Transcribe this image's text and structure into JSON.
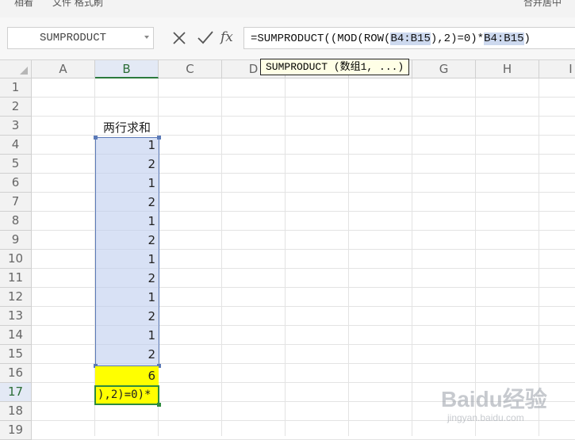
{
  "toolbar": {
    "left_fragment": "相看",
    "middle_fragment": "文件 格式刷",
    "right_fragment": "合并居中"
  },
  "name_box": {
    "value": "SUMPRODUCT"
  },
  "formula_bar": {
    "fx_label": "fx",
    "formula_parts": [
      "=SUMPRODUCT((MOD(ROW(",
      "B4:B15",
      "),2)=0)*",
      "B4:B15",
      ")"
    ]
  },
  "tooltip": {
    "text": "SUMPRODUCT (数组1, ...)"
  },
  "columns": [
    "A",
    "B",
    "C",
    "D",
    "E",
    "F",
    "G",
    "H",
    "I"
  ],
  "active_column": "B",
  "rows": [
    "1",
    "2",
    "3",
    "4",
    "5",
    "6",
    "7",
    "8",
    "9",
    "10",
    "11",
    "12",
    "13",
    "14",
    "15",
    "16",
    "17",
    "18",
    "19"
  ],
  "active_row": "17",
  "sheet": {
    "header_cell": "两行求和",
    "values": [
      "1",
      "2",
      "1",
      "2",
      "1",
      "2",
      "1",
      "2",
      "1",
      "2",
      "1",
      "2"
    ],
    "total": "6",
    "editing_text": "),2)=0)*"
  },
  "colors": {
    "selection": "#cdd9ef",
    "highlight": "#ffff00",
    "active_border": "#2e8b3e"
  },
  "watermark": {
    "main": "Baidu经验",
    "sub": "jingyan.baidu.com"
  }
}
